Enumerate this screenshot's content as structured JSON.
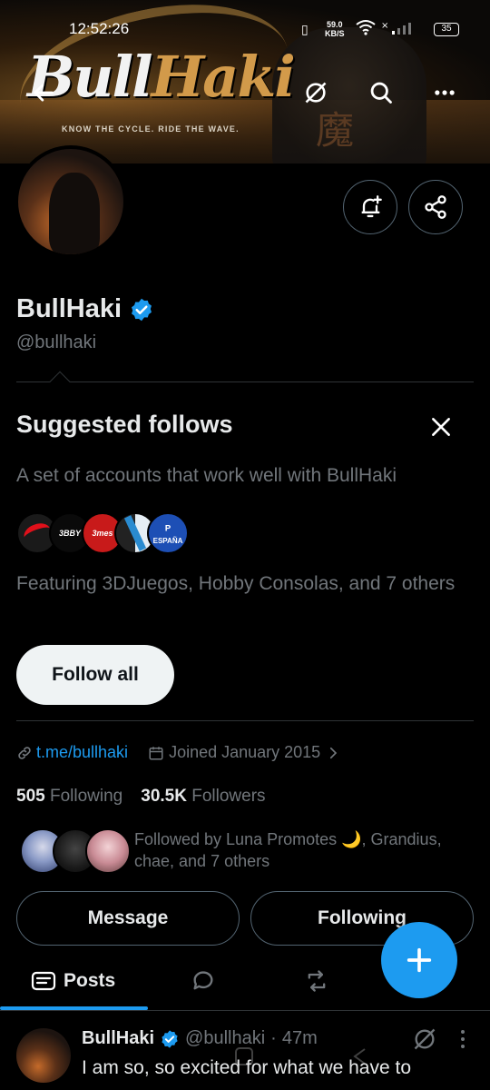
{
  "status_bar": {
    "time": "12:52:26",
    "net_speed_value": "59.0",
    "net_speed_unit": "KB/S",
    "battery": "35"
  },
  "banner": {
    "logo_part1": "Bull",
    "logo_part2": "Haki",
    "tagline": "KNOW THE CYCLE. RIDE THE WAVE.",
    "kanji": "魔"
  },
  "profile": {
    "display_name": "BullHaki",
    "handle": "@bullhaki",
    "verified_color": "#1d9bf0",
    "link": "t.me/bullhaki",
    "joined": "Joined January 2015",
    "following_count": "505",
    "following_label": "Following",
    "followers_count": "30.5K",
    "followers_label": "Followers",
    "followed_by": "Followed by Luna Promotes 🌙, Grandius, chae, and 7 others"
  },
  "suggested": {
    "title": "Suggested follows",
    "description": "A set of accounts that work well with BullHaki",
    "avatar_labels": [
      "",
      "3BBY",
      "3mes",
      "",
      "ESPAÑA"
    ],
    "featuring": "Featuring 3DJuegos, Hobby Consolas, and 7 others",
    "follow_all": "Follow all"
  },
  "actions": {
    "message": "Message",
    "following": "Following"
  },
  "tabs": {
    "posts": "Posts"
  },
  "post": {
    "name": "BullHaki",
    "handle": "@bullhaki",
    "dot": "·",
    "time": "47m",
    "text": "I am so, so excited for what we have to"
  },
  "colors": {
    "accent": "#1d9bf0",
    "background": "#000000",
    "muted_text": "#71767b"
  }
}
